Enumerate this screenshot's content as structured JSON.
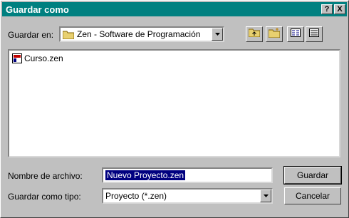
{
  "window": {
    "title": "Guardar como",
    "help_button": "?",
    "close_button": "X"
  },
  "location": {
    "label": "Guardar en:",
    "value": "Zen - Software de Programación"
  },
  "toolbar": {
    "icons": [
      "up-folder-icon",
      "new-folder-icon",
      "list-view-icon",
      "details-view-icon"
    ]
  },
  "files": [
    {
      "name": "Curso.zen",
      "icon": "zen-file-icon"
    }
  ],
  "filename": {
    "label": "Nombre de archivo:",
    "value": "Nuevo Proyecto.zen"
  },
  "filetype": {
    "label": "Guardar como tipo:",
    "value": "Proyecto (*.zen)"
  },
  "buttons": {
    "save": "Guardar",
    "cancel": "Cancelar"
  },
  "colors": {
    "titlebar": "#008080",
    "face": "#c0c0c0",
    "selection": "#000080"
  }
}
